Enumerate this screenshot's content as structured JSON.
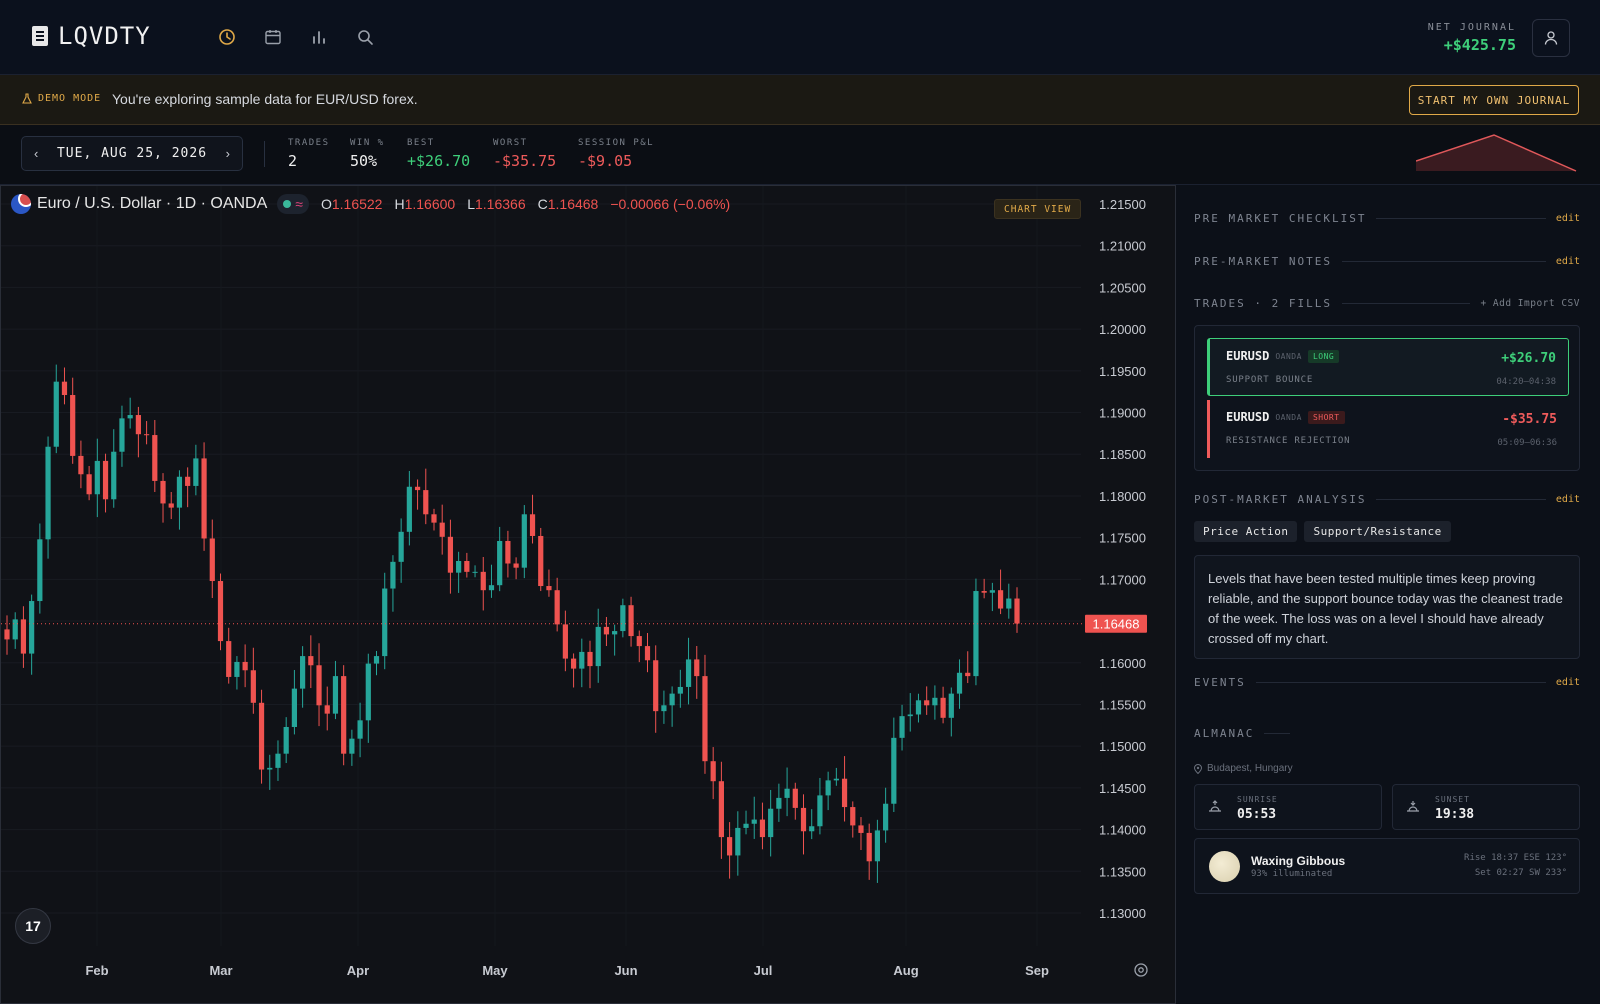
{
  "app": {
    "name": "LQVDTY"
  },
  "nav": {
    "icons": [
      "clock-icon",
      "calendar-icon",
      "bar-chart-icon",
      "search-icon"
    ],
    "active_color": "#e0a948"
  },
  "net_journal": {
    "label": "NET JOURNAL",
    "value": "+$425.75"
  },
  "demo": {
    "tag": "DEMO MODE",
    "text": "You're exploring sample data for EUR/USD forex.",
    "button": "START MY OWN JOURNAL"
  },
  "stats": {
    "date": "TUE, AUG 25, 2026",
    "items": [
      {
        "label": "TRADES",
        "value": "2",
        "color": "#f0f0f0"
      },
      {
        "label": "WIN %",
        "value": "50%",
        "color": "#f0f0f0"
      },
      {
        "label": "BEST",
        "value": "+$26.70",
        "color": "#3ecf7a"
      },
      {
        "label": "WORST",
        "value": "-$35.75",
        "color": "#ef5b5b"
      },
      {
        "label": "SESSION P&L",
        "value": "-$9.05",
        "color": "#ef5b5b"
      }
    ]
  },
  "chart": {
    "symbol": "Euro / U.S. Dollar · 1D · OANDA",
    "o_label": "O",
    "o": "1.16522",
    "h_label": "H",
    "h": "1.16600",
    "l_label": "L",
    "l": "1.16366",
    "c_label": "C",
    "c": "1.16468",
    "change": "−0.00066 (−0.06%)",
    "view_label": "CHART VIEW",
    "last_price": "1.16468",
    "tv_logo": "17"
  },
  "chart_data": {
    "type": "candlestick",
    "title": "Euro / U.S. Dollar · 1D · OANDA",
    "x_tick_labels": [
      "Feb",
      "Mar",
      "Apr",
      "May",
      "Jun",
      "Jul",
      "Aug",
      "Sep"
    ],
    "y_tick_labels": [
      "1.21500",
      "1.21000",
      "1.20500",
      "1.20000",
      "1.19500",
      "1.19000",
      "1.18500",
      "1.18000",
      "1.17500",
      "1.17000",
      "1.16500",
      "1.16000",
      "1.15500",
      "1.15000",
      "1.14500",
      "1.14000",
      "1.13500",
      "1.13000"
    ],
    "ylim": [
      1.128,
      1.217
    ],
    "last_price": 1.16468,
    "up_color": "#26a69a",
    "down_color": "#ef5350",
    "close_series": [
      1.1628,
      1.1652,
      1.1611,
      1.1674,
      1.1748,
      1.1859,
      1.1937,
      1.1921,
      1.1848,
      1.1826,
      1.1802,
      1.1842,
      1.1796,
      1.1853,
      1.1893,
      1.1897,
      1.1874,
      1.1873,
      1.1818,
      1.1791,
      1.1786,
      1.1823,
      1.1812,
      1.1845,
      1.1749,
      1.1698,
      1.1626,
      1.1583,
      1.1601,
      1.1591,
      1.1552,
      1.1472,
      1.1474,
      1.1491,
      1.1523,
      1.1569,
      1.1608,
      1.1597,
      1.1549,
      1.1539,
      1.1584,
      1.1491,
      1.1509,
      1.1531,
      1.1599,
      1.1608,
      1.1689,
      1.1721,
      1.1757,
      1.1811,
      1.1807,
      1.1778,
      1.1768,
      1.1751,
      1.1708,
      1.1722,
      1.1709,
      1.1709,
      1.1687,
      1.1693,
      1.1746,
      1.1719,
      1.1714,
      1.1778,
      1.1752,
      1.1692,
      1.1687,
      1.1646,
      1.1605,
      1.1593,
      1.1613,
      1.1596,
      1.1643,
      1.1634,
      1.1638,
      1.1669,
      1.1632,
      1.162,
      1.1603,
      1.1542,
      1.1549,
      1.1563,
      1.1571,
      1.1604,
      1.1584,
      1.1482,
      1.1458,
      1.1391,
      1.1369,
      1.1402,
      1.1407,
      1.1412,
      1.1391,
      1.1425,
      1.1438,
      1.1449,
      1.1426,
      1.1398,
      1.1404,
      1.1441,
      1.1459,
      1.1461,
      1.1427,
      1.1405,
      1.1396,
      1.1362,
      1.1399,
      1.1431,
      1.151,
      1.1536,
      1.1538,
      1.1555,
      1.1549,
      1.1558,
      1.1534,
      1.1563,
      1.1588,
      1.1584,
      1.1686,
      1.1684,
      1.1687,
      1.1665,
      1.1677,
      1.1647
    ],
    "xlabel": "",
    "ylabel": ""
  },
  "right": {
    "premarket_checklist": {
      "title": "PRE MARKET CHECKLIST",
      "edit": "edit"
    },
    "premarket_notes": {
      "title": "PRE-MARKET NOTES",
      "edit": "edit"
    },
    "trades": {
      "title": "TRADES · 2 FILLS",
      "actions": "+ Add  Import CSV",
      "items": [
        {
          "symbol": "EURUSD",
          "broker": "OANDA",
          "side": "LONG",
          "pnl": "+$26.70",
          "setup": "SUPPORT BOUNCE",
          "time": "04:20–04:38",
          "color": "#3ecf7a",
          "side_bg": "#163a28"
        },
        {
          "symbol": "EURUSD",
          "broker": "OANDA",
          "side": "SHORT",
          "pnl": "-$35.75",
          "setup": "RESISTANCE REJECTION",
          "time": "05:09–06:36",
          "color": "#ef5b5b",
          "side_bg": "#3b1a1c"
        }
      ]
    },
    "post_market": {
      "title": "POST-MARKET ANALYSIS",
      "edit": "edit",
      "tags": [
        "Price Action",
        "Support/Resistance"
      ],
      "text": "Levels that have been tested multiple times keep proving reliable, and the support bounce today was the cleanest trade of the week. The loss was on a level I should have already crossed off my chart."
    },
    "events": {
      "title": "EVENTS",
      "edit": "edit"
    },
    "almanac": {
      "title": "ALMANAC",
      "location": "Budapest, Hungary",
      "sunrise_label": "SUNRISE",
      "sunrise": "05:53",
      "sunset_label": "SUNSET",
      "sunset": "19:38",
      "moon_phase": "Waxing Gibbous",
      "moon_illum": "93% illuminated",
      "moon_rise": "Rise 18:37 ESE 123°",
      "moon_set": "Set 02:27 SW 233°"
    }
  }
}
